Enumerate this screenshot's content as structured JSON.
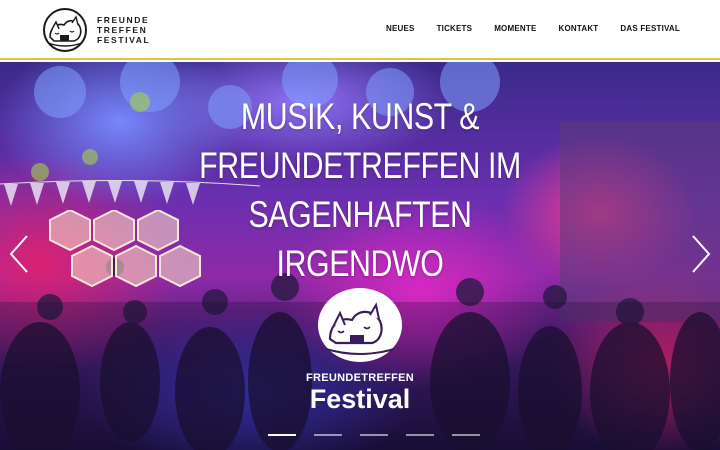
{
  "header": {
    "logo_lines": [
      "FREUNDE",
      "TREFFEN",
      "FESTIVAL"
    ],
    "nav": [
      "NEUES",
      "TICKETS",
      "MOMENTE",
      "KONTAKT",
      "DAS FESTIVAL"
    ]
  },
  "hero": {
    "tagline": [
      "MUSIK, KUNST &",
      "FREUNDETREFFEN IM",
      "SAGENHAFTEN IRGENDWO"
    ],
    "festival_name": "FREUNDETREFFEN",
    "festival_sub": "Festival",
    "slide_count": 5,
    "active_slide": 1
  },
  "colors": {
    "accent": "#e8c23a",
    "text": "#111111",
    "hero_text": "#ffffff"
  },
  "icons": {
    "logo": "sleeping-fox-cat-emblem",
    "prev": "chevron-left-icon",
    "next": "chevron-right-icon"
  }
}
